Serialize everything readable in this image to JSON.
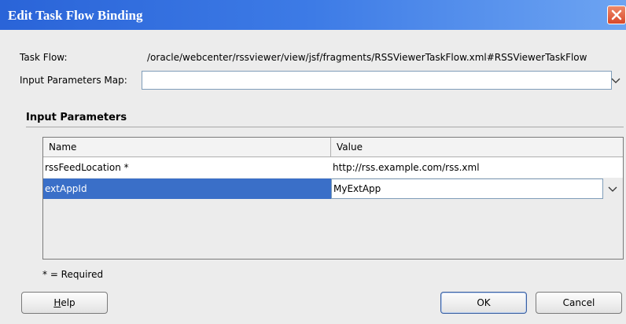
{
  "dialog": {
    "title": "Edit Task Flow Binding",
    "task_flow_label": "Task Flow:",
    "task_flow_value": "/oracle/webcenter/rssviewer/view/jsf/fragments/RSSViewerTaskFlow.xml#RSSViewerTaskFlow",
    "params_map_label": "Input Parameters Map:",
    "params_map_value": ""
  },
  "parameters": {
    "section_title": "Input Parameters",
    "columns": [
      "Name",
      "Value"
    ],
    "rows": [
      {
        "name": "rssFeedLocation *",
        "value": "http://rss.example.com/rss.xml"
      },
      {
        "name": "extAppId",
        "value": "MyExtApp"
      }
    ],
    "required_note": "* = Required"
  },
  "buttons": {
    "help_mnemonic": "H",
    "help_rest": "elp",
    "ok": "OK",
    "cancel": "Cancel"
  },
  "colors": {
    "titlebar": "#2a64d8",
    "selection": "#3a6fc8",
    "close": "#d9482a"
  },
  "icons": [
    "close-icon",
    "chevron-down-icon"
  ]
}
